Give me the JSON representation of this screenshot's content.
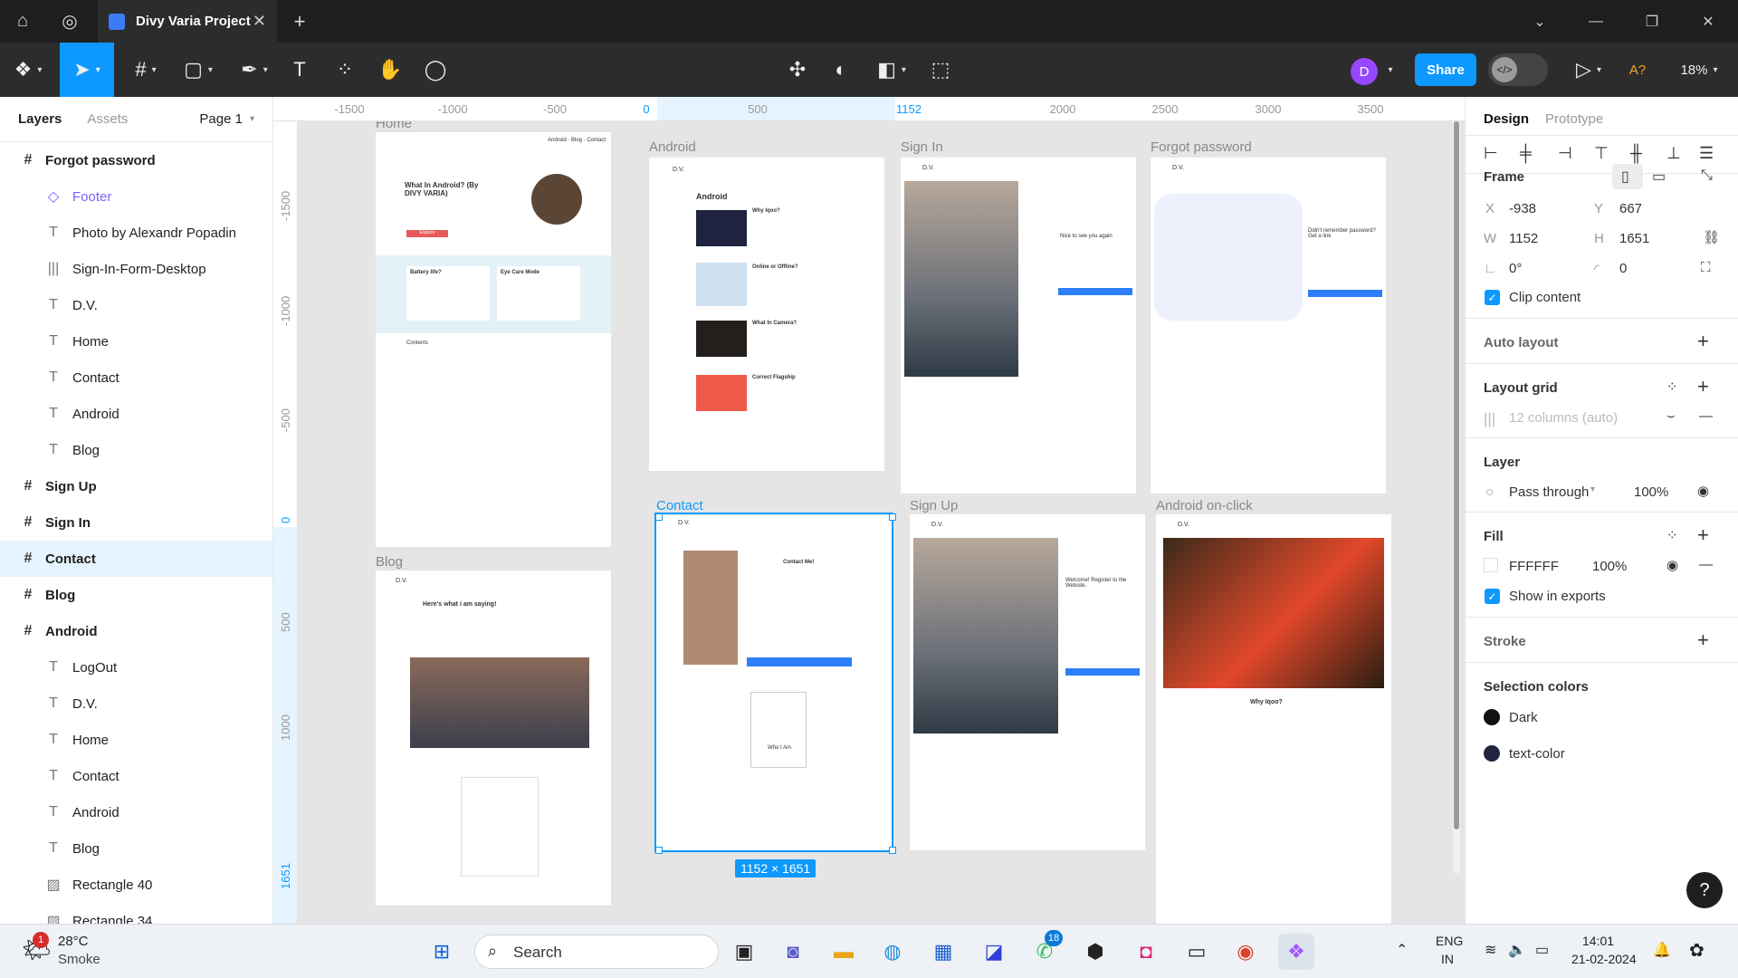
{
  "window": {
    "tab_title": "Divy Varia Project",
    "tab_close": "✕",
    "new_tab": "+"
  },
  "toolbar": {
    "avatar_initial": "D",
    "share_label": "Share",
    "translate": "A?",
    "zoom": "18%"
  },
  "left_panel": {
    "tab_layers": "Layers",
    "tab_assets": "Assets",
    "page": "Page 1",
    "layers": [
      {
        "label": "Forgot password",
        "kind": "frame",
        "level": 0
      },
      {
        "label": "Footer",
        "kind": "component",
        "level": 1
      },
      {
        "label": "Photo by Alexandr Popadin",
        "kind": "text",
        "level": 1
      },
      {
        "label": "Sign-In-Form-Desktop",
        "kind": "columns",
        "level": 1
      },
      {
        "label": "D.V.",
        "kind": "text",
        "level": 1
      },
      {
        "label": "Home",
        "kind": "text",
        "level": 1
      },
      {
        "label": "Contact",
        "kind": "text",
        "level": 1
      },
      {
        "label": "Android",
        "kind": "text",
        "level": 1
      },
      {
        "label": "Blog",
        "kind": "text",
        "level": 1
      },
      {
        "label": "Sign Up",
        "kind": "frame",
        "level": 0
      },
      {
        "label": "Sign In",
        "kind": "frame",
        "level": 0
      },
      {
        "label": "Contact",
        "kind": "frame",
        "level": 0,
        "selected": true
      },
      {
        "label": "Blog",
        "kind": "frame",
        "level": 0
      },
      {
        "label": "Android",
        "kind": "frame",
        "level": 0
      },
      {
        "label": "LogOut",
        "kind": "text",
        "level": 1
      },
      {
        "label": "D.V.",
        "kind": "text",
        "level": 1
      },
      {
        "label": "Home",
        "kind": "text",
        "level": 1
      },
      {
        "label": "Contact",
        "kind": "text",
        "level": 1
      },
      {
        "label": "Android",
        "kind": "text",
        "level": 1
      },
      {
        "label": "Blog",
        "kind": "text",
        "level": 1
      },
      {
        "label": "Rectangle 40",
        "kind": "image",
        "level": 1
      },
      {
        "label": "Rectangle 34",
        "kind": "image",
        "level": 1
      }
    ]
  },
  "rulers": {
    "top": [
      "-1500",
      "-1000",
      "-500",
      "0",
      "500",
      "1152",
      "2000",
      "2500",
      "3000",
      "3500"
    ],
    "left": [
      "-1500",
      "-1000",
      "-500",
      "0",
      "500",
      "1000",
      "1651"
    ]
  },
  "canvas": {
    "frames": {
      "home": "Home",
      "android": "Android",
      "signin": "Sign In",
      "forgot": "Forgot password",
      "blog": "Blog",
      "contact": "Contact",
      "signup": "Sign Up",
      "android_click": "Android on-click"
    },
    "selection_size": "1152 × 1651",
    "home": {
      "title": "What In Android? (By DIVY VARIA)",
      "explore": "Explore",
      "card1": "Battery life?",
      "card2": "Eye Care Mode",
      "contents": "Contents"
    },
    "android": {
      "logo": "D.V.",
      "heading": "Android",
      "q1": "Why Iqoo?",
      "q2": "Online or Offline?",
      "q3": "What In Camera?",
      "q4": "Correct Flagship"
    },
    "signin": {
      "logo": "D.V.",
      "prompt": "Nice to see you again"
    },
    "forgot": {
      "logo": "D.V.",
      "prompt": "Didn't remember password? Get a link"
    },
    "blog": {
      "logo": "D.V.",
      "heading": "Here's what i am saying!"
    },
    "contact": {
      "logo": "D.V.",
      "heading": "Contact Me!",
      "who": "Who I Am"
    },
    "signup": {
      "logo": "D.V.",
      "heading": "Welcome! Register to the Website."
    },
    "android_click": {
      "logo": "D.V.",
      "heading": "Why Iqoo?"
    }
  },
  "right_panel": {
    "tab_design": "Design",
    "tab_prototype": "Prototype",
    "frame_label": "Frame",
    "x_label": "X",
    "x": "-938",
    "y_label": "Y",
    "y": "667",
    "w_label": "W",
    "w": "1152",
    "h_label": "H",
    "h": "1651",
    "rotation": "0°",
    "radius": "0",
    "clip_content": "Clip content",
    "auto_layout": "Auto layout",
    "layout_grid": "Layout grid",
    "grid_value": "12 columns (auto)",
    "layer": "Layer",
    "blend": "Pass through",
    "layer_opacity": "100%",
    "fill": "Fill",
    "fill_hex": "FFFFFF",
    "fill_opacity": "100%",
    "show_exports": "Show in exports",
    "stroke": "Stroke",
    "selection_colors": "Selection colors",
    "colors": [
      {
        "name": "Dark",
        "hex": "#111111"
      },
      {
        "name": "text-color",
        "hex": "#22253f"
      }
    ]
  },
  "taskbar": {
    "temp": "28°C",
    "weather": "Smoke",
    "weather_badge": "1",
    "search": "Search",
    "whatsapp_badge": "18",
    "lang1": "ENG",
    "lang2": "IN",
    "time": "14:01",
    "date": "21-02-2024"
  },
  "colors": {
    "accent": "#0d99ff",
    "dark": "#1e1e1e",
    "toolbar": "#2c2c2c"
  }
}
